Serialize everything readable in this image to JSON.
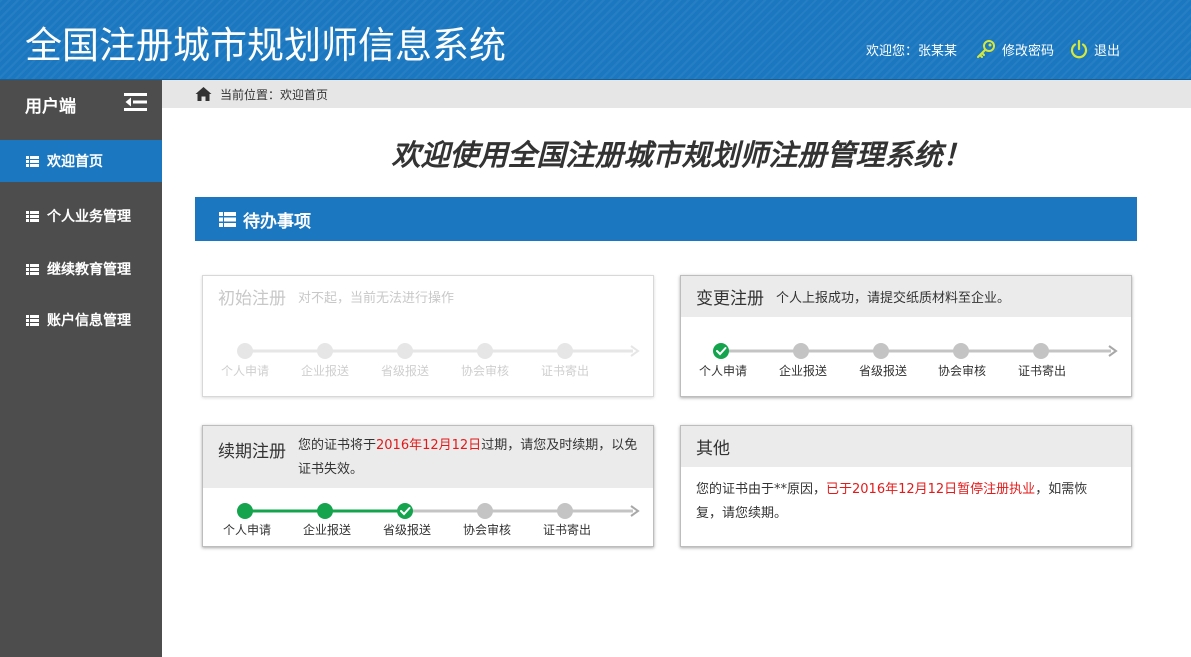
{
  "header": {
    "app_title": "全国注册城市规划师信息系统",
    "welcome_text": "欢迎您：张某某",
    "change_password_label": "修改密码",
    "logout_label": "退出"
  },
  "sidebar": {
    "title": "用户端",
    "items": [
      {
        "label": "欢迎首页",
        "active": true
      },
      {
        "label": "个人业务管理",
        "active": false
      },
      {
        "label": "继续教育管理",
        "active": false
      },
      {
        "label": "账户信息管理",
        "active": false
      }
    ]
  },
  "breadcrumb": {
    "text": "当前位置：欢迎首页"
  },
  "main": {
    "welcome_heading": "欢迎使用全国注册城市规划师注册管理系统！",
    "section_title": "待办事项",
    "step_labels": [
      "个人申请",
      "企业报送",
      "省级报送",
      "协会审核",
      "证书寄出"
    ],
    "cards": {
      "initial": {
        "title": "初始注册",
        "message": "对不起，当前无法进行操作",
        "status": "disabled"
      },
      "change": {
        "title": "变更注册",
        "message": "个人上报成功，请提交纸质材料至企业。",
        "completed_steps": 1
      },
      "renewal": {
        "title": "续期注册",
        "message_pre": "您的证书将于",
        "message_date": "2016年12月12日",
        "message_post": "过期，请您及时续期，以免证书失效。",
        "completed_steps": 3
      },
      "other": {
        "title": "其他",
        "body_pre": "您的证书由于**原因，",
        "body_red": "已于2016年12月12日暂停注册执业",
        "body_post": "，如需恢复，请您续期。"
      }
    }
  },
  "colors": {
    "brand_blue": "#1b78c0",
    "sidebar_gray": "#4d4d4d",
    "step_done_green": "#14a44d",
    "step_pending_gray": "#c4c4c4",
    "alert_red": "#e41a1a"
  }
}
